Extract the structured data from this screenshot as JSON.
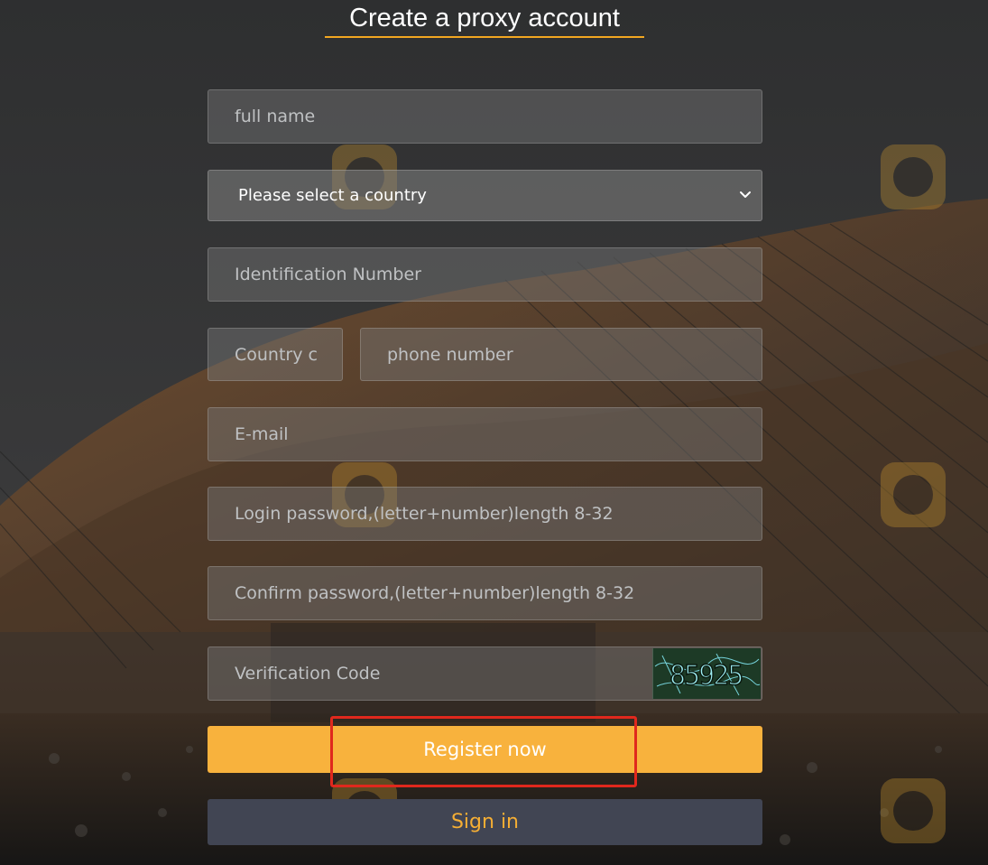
{
  "page": {
    "title": "Create a proxy account"
  },
  "form": {
    "full_name": {
      "placeholder": "full name"
    },
    "country_select": {
      "selected": "Please select a country"
    },
    "id_number": {
      "placeholder": "Identification Number"
    },
    "country_code": {
      "placeholder": "Country c"
    },
    "phone": {
      "placeholder": "phone number"
    },
    "email": {
      "placeholder": "E-mail"
    },
    "password": {
      "placeholder": "Login password,(letter+number)length 8-32"
    },
    "confirm_password": {
      "placeholder": "Confirm password,(letter+number)length 8-32"
    },
    "verification": {
      "placeholder": "Verification Code",
      "captcha_text": "85925"
    }
  },
  "buttons": {
    "register": "Register now",
    "signin": "Sign in"
  },
  "colors": {
    "accent": "#f8b23d",
    "title_underline": "#f2a721",
    "signin_bg": "#414553",
    "signin_text": "#f5ae34",
    "highlight_box": "#e0281d"
  },
  "icons": {
    "select_arrow": "chevron-down-icon"
  }
}
